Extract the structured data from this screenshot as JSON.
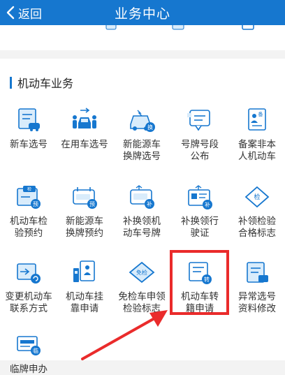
{
  "header": {
    "back_label": "返回",
    "title": "业务中心"
  },
  "peek": {
    "text": "⋯⋯⋯"
  },
  "section": {
    "title": "机动车业务"
  },
  "items": [
    {
      "label": "新车选号"
    },
    {
      "label": "在用车选号"
    },
    {
      "label": "新能源车\n换牌选号",
      "badge": "换"
    },
    {
      "label": "号牌号段\n公布"
    },
    {
      "label": "备案非本\n人机动车",
      "badge": "备"
    },
    {
      "label": "机动车检\n验预约",
      "badge": "预",
      "tag": "检"
    },
    {
      "label": "新能源车\n换牌预约",
      "badge": "预"
    },
    {
      "label": "补换领机\n动车号牌",
      "badge": "补"
    },
    {
      "label": "补换领行\n驶证",
      "badge": "补"
    },
    {
      "label": "补领检验\n合格标志",
      "tag": "检"
    },
    {
      "label": "变更机动车\n联系方式"
    },
    {
      "label": "机动车挂\n靠申请"
    },
    {
      "label": "免检车申领\n检验标志",
      "tag": "免检"
    },
    {
      "label": "机动车转\n籍申请",
      "badge": "转"
    },
    {
      "label": "异常选号\n资料修改"
    },
    {
      "label": "临牌申办",
      "badge": "临"
    }
  ],
  "colors": {
    "primary": "#1677cf",
    "icon_light": "#d9ecfb",
    "annotation": "#ea2b2b"
  }
}
